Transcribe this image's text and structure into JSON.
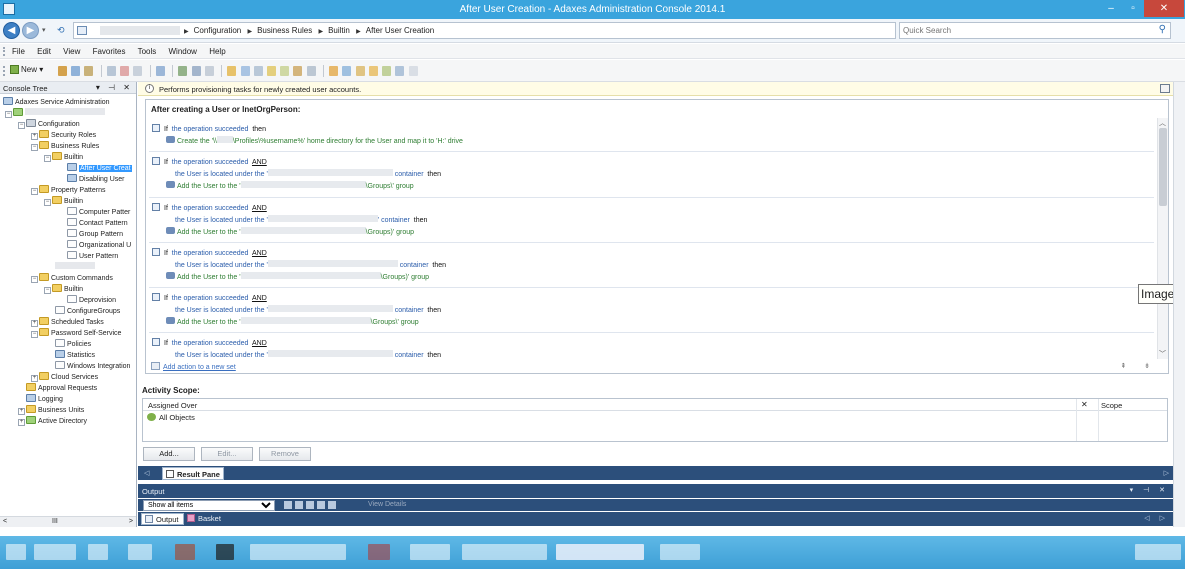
{
  "window": {
    "title": "After User Creation - Adaxes Administration Console 2014.1",
    "controls": [
      "–",
      "▫",
      "✕"
    ]
  },
  "address": {
    "breadcrumbs": [
      "Configuration",
      "Business Rules",
      "Builtin",
      "After User Creation"
    ],
    "search_placeholder": "Quick Search"
  },
  "menu": [
    "File",
    "Edit",
    "View",
    "Favorites",
    "Tools",
    "Window",
    "Help"
  ],
  "toolbar": {
    "new_label": "New",
    "new_dropdown": "▾"
  },
  "tree": {
    "header": "Console Tree",
    "header_controls": "▾ ⊣ ✕",
    "scroll": {
      "left": "<",
      "middle": "III",
      "right": ">"
    },
    "nodes": [
      {
        "label": "Adaxes Service Administration"
      },
      {
        "label": "Configuration"
      },
      {
        "label": "Security Roles"
      },
      {
        "label": "Business Rules"
      },
      {
        "label": "Builtin"
      },
      {
        "label": "After User Creat",
        "selected": true
      },
      {
        "label": "Disabling User"
      },
      {
        "label": "Property Patterns"
      },
      {
        "label": "Builtin"
      },
      {
        "label": "Computer Patter"
      },
      {
        "label": "Contact Pattern"
      },
      {
        "label": "Group Pattern"
      },
      {
        "label": "Organizational U"
      },
      {
        "label": "User Pattern"
      },
      {
        "label": "Custom Commands"
      },
      {
        "label": "Builtin"
      },
      {
        "label": "Deprovision"
      },
      {
        "label": "ConfigureGroups"
      },
      {
        "label": "Scheduled Tasks"
      },
      {
        "label": "Password Self-Service"
      },
      {
        "label": "Policies"
      },
      {
        "label": "Statistics"
      },
      {
        "label": "Windows Integration"
      },
      {
        "label": "Cloud Services"
      },
      {
        "label": "Approval Requests"
      },
      {
        "label": "Logging"
      },
      {
        "label": "Business Units"
      },
      {
        "label": "Active Directory"
      }
    ]
  },
  "infobar": {
    "text": "Performs provisioning tasks for newly created user accounts."
  },
  "rules": {
    "heading": "After creating a User or InetOrgPerson:",
    "if_kw": "If",
    "then_kw": "then",
    "and_kw": "AND",
    "block1": {
      "cond": "the operation succeeded",
      "action_pre": "Create the '\\\\",
      "action_post": "\\Profiles\\%username%' home directory for the User and map it to 'H:' drive"
    },
    "cond_succeeded": "the operation succeeded",
    "located_pre": "the User is located under the '",
    "container_kw": "container",
    "container_kw2": "' container",
    "add_pre": "Add the User to the '",
    "groups_post": "\\Groups\\' group",
    "groups_post2": "\\Groups)' group",
    "add_action_link": "Add action to a new set",
    "reorder": "⇞ ⇟"
  },
  "tooltip": {
    "text": "ImageE"
  },
  "scope": {
    "title": "Activity Scope:",
    "col_assigned": "Assigned Over",
    "col_scope": "Scope",
    "col_x": "✕",
    "row": "All Objects",
    "buttons": {
      "add": "Add...",
      "edit": "Edit...",
      "remove": "Remove"
    }
  },
  "result": {
    "tab": "Result Pane",
    "arrow_left": "◁",
    "arrow_right": "▷"
  },
  "output": {
    "title": "Output",
    "controls": "▾ ⊣ ✕",
    "filter_selected": "Show all items",
    "view_details": "View Details",
    "tabs": [
      "Output",
      "Basket"
    ],
    "tab_arrows": "◁ ▷"
  }
}
